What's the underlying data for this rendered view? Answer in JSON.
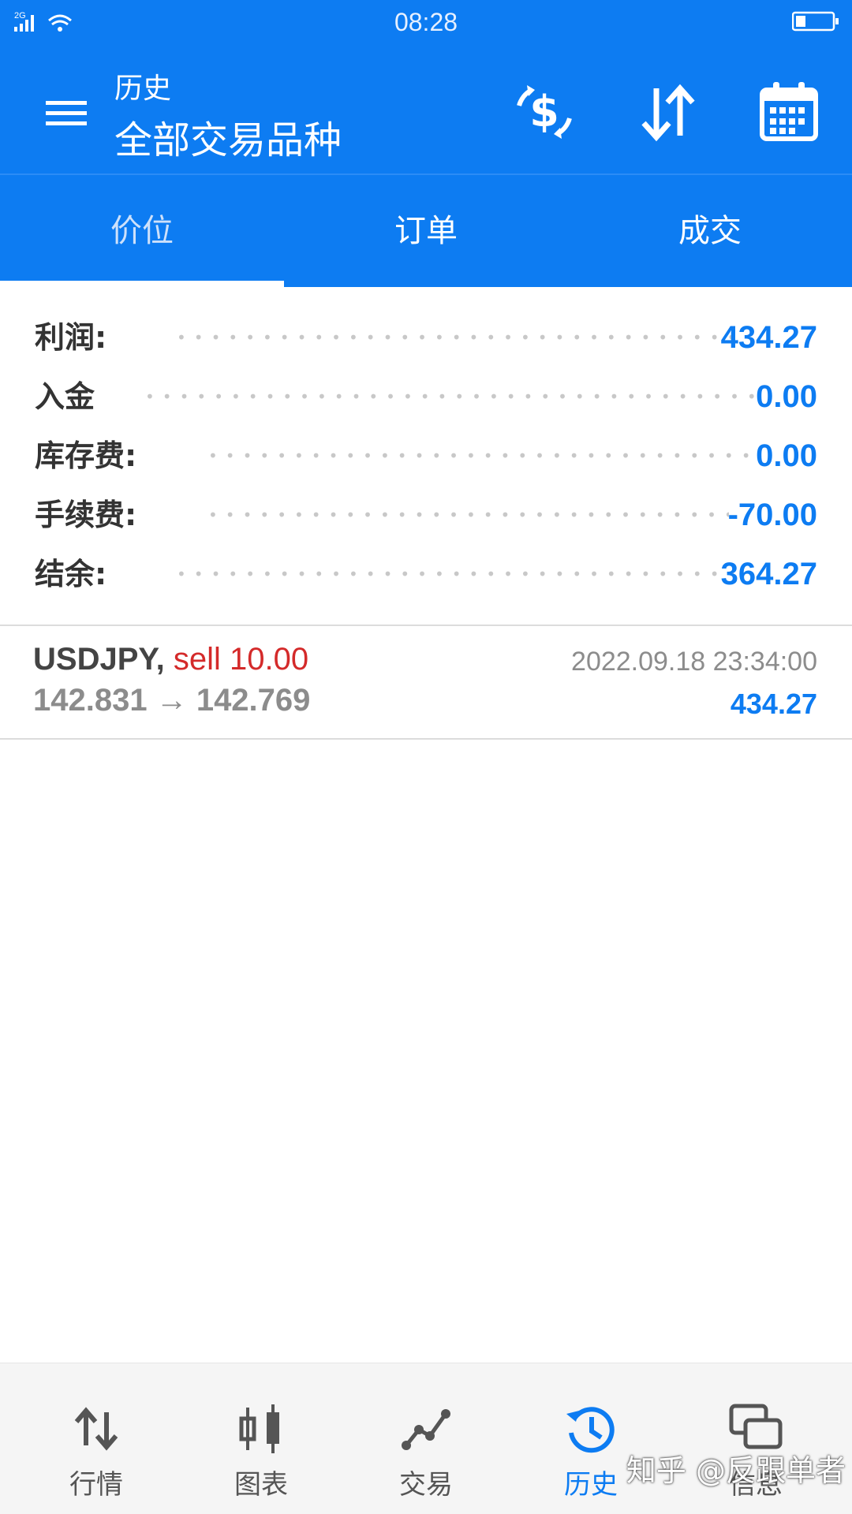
{
  "status_bar": {
    "network": "2G",
    "time": "08:28"
  },
  "app_bar": {
    "title": "历史",
    "subtitle": "全部交易品种",
    "actions": [
      "money-icon",
      "sort-icon",
      "calendar-icon"
    ]
  },
  "tabs": [
    {
      "label": "价位",
      "selected": true
    },
    {
      "label": "订单",
      "selected": false
    },
    {
      "label": "成交",
      "selected": false
    }
  ],
  "summary": [
    {
      "label": "利润:",
      "value": "434.27"
    },
    {
      "label": "入金",
      "value": "0.00"
    },
    {
      "label": "库存费:",
      "value": "0.00"
    },
    {
      "label": "手续费:",
      "value": "-70.00"
    },
    {
      "label": "结余:",
      "value": "364.27"
    }
  ],
  "deals": [
    {
      "symbol": "USDJPY,",
      "side": "sell 10.00",
      "prices": "142.831 → 142.769",
      "time": "2022.09.18 23:34:00",
      "profit": "434.27"
    }
  ],
  "bottom_nav": [
    {
      "label": "行情",
      "icon": "quotes-icon",
      "active": false
    },
    {
      "label": "图表",
      "icon": "chart-icon",
      "active": false
    },
    {
      "label": "交易",
      "icon": "trade-icon",
      "active": false
    },
    {
      "label": "历史",
      "icon": "history-icon",
      "active": true
    },
    {
      "label": "信息",
      "icon": "messages-icon",
      "active": false
    }
  ],
  "watermark": "知乎 @反跟单者",
  "colors": {
    "primary": "#0d7cf2",
    "sell": "#d42a2a",
    "muted": "#8c8c8c"
  }
}
